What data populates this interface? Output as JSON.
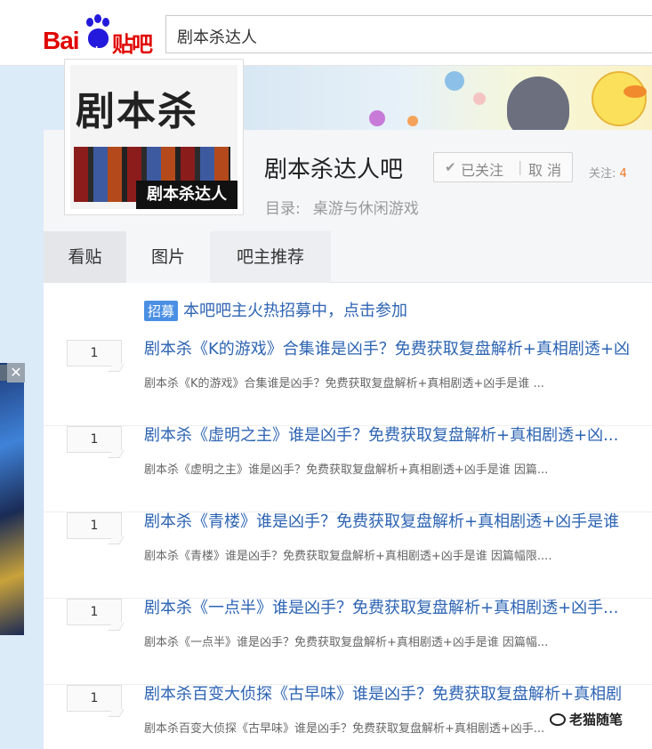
{
  "header": {
    "logo_bai": "Bai",
    "logo_du": "du",
    "logo_tieba": "贴吧",
    "search_value": "剧本杀达人"
  },
  "forum": {
    "avatar_title": "剧本杀",
    "avatar_plate": "剧本杀达人",
    "name": "剧本杀达人吧",
    "follow_label": "已关注",
    "follow_separator": "|",
    "cancel_label": "取 消",
    "followers_label": "关注:",
    "followers_count": "4",
    "catalog_label": "目录:",
    "catalog_value": "桌游与休闲游戏"
  },
  "tabs": [
    {
      "label": "看贴"
    },
    {
      "label": "图片"
    },
    {
      "label": "吧主推荐"
    }
  ],
  "recruit": {
    "tag": "招募",
    "text": "本吧吧主火热招募中，点击参加"
  },
  "threads": [
    {
      "replies": "1",
      "title": "剧本杀《K的游戏》合集谁是凶手？免费获取复盘解析+真相剧透+凶",
      "abstract": "剧本杀《K的游戏》合集谁是凶手？免费获取复盘解析+真相剧透+凶手是谁 ..."
    },
    {
      "replies": "1",
      "title": "剧本杀《虚明之主》谁是凶手？免费获取复盘解析+真相剧透+凶...",
      "abstract": "剧本杀《虚明之主》谁是凶手？免费获取复盘解析+真相剧透+凶手是谁 因篇..."
    },
    {
      "replies": "1",
      "title": "剧本杀《青楼》谁是凶手？免费获取复盘解析+真相剧透+凶手是谁",
      "abstract": "剧本杀《青楼》谁是凶手？免费获取复盘解析+真相剧透+凶手是谁 因篇幅限...."
    },
    {
      "replies": "1",
      "title": "剧本杀《一点半》谁是凶手？免费获取复盘解析+真相剧透+凶手...",
      "abstract": "剧本杀《一点半》谁是凶手？免费获取复盘解析+真相剧透+凶手是谁 因篇幅..."
    },
    {
      "replies": "1",
      "title": "剧本杀百变大侦探《古早味》谁是凶手？免费获取复盘解析+真相剧",
      "abstract": "剧本杀百变大侦探《古早味》谁是凶手？免费获取复盘解析+真相剧透+凶手..."
    }
  ],
  "watermark": "老猫随笔",
  "colors": {
    "link_blue": "#2d64b3",
    "brand_red": "#e10601",
    "brand_blue": "#2319dc",
    "follower_count": "#ee7722"
  }
}
